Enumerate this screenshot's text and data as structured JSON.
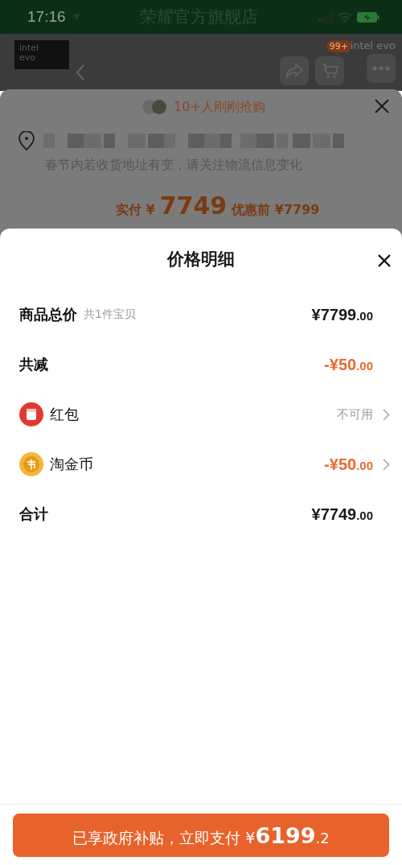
{
  "status_bar": {
    "time": "17:16",
    "title": "荣耀官方旗舰店"
  },
  "header": {
    "logo_top": "intel",
    "logo_bottom": "evo",
    "brand_right_top": "intel",
    "brand_right_bottom": "evo",
    "cart_badge": "99+"
  },
  "order_sheet": {
    "buyers_note": "10+人刚刚抢购",
    "address_hint": "春节内若收货地址有变，请关注物流信息变化",
    "paid_label": "实付 ¥",
    "paid_amount": "7749",
    "before_label": "优惠前 ¥7799"
  },
  "price_sheet": {
    "title": "价格明细",
    "rows": [
      {
        "kind": "plain",
        "label": "商品总价",
        "note": "共1件宝贝",
        "amount": "¥7799",
        "decimal": ".00",
        "discount": false,
        "chevron": false
      },
      {
        "kind": "plain",
        "label": "共减",
        "amount": "-¥50",
        "decimal": ".00",
        "discount": true,
        "chevron": false
      },
      {
        "kind": "redpacket",
        "label": "红包",
        "status": "不可用",
        "chevron": true
      },
      {
        "kind": "coin",
        "label": "淘金币",
        "amount": "-¥50",
        "decimal": ".00",
        "discount": true,
        "chevron": true
      },
      {
        "kind": "plain",
        "label": "合计",
        "amount": "¥7749",
        "decimal": ".00",
        "discount": false,
        "chevron": false
      }
    ]
  },
  "pay_button": {
    "label": "已享政府补贴，立即支付",
    "currency": "¥",
    "amount": "6199",
    "decimal": ".2"
  }
}
